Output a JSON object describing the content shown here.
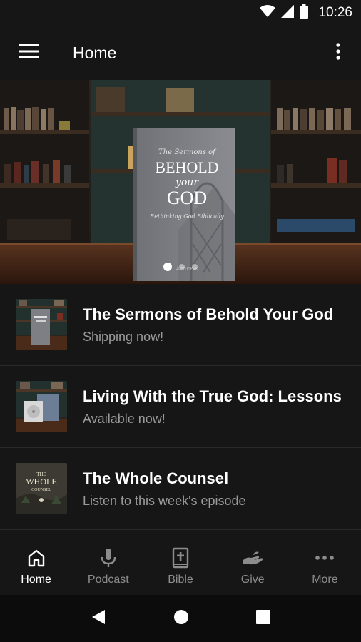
{
  "status_bar": {
    "time": "10:26"
  },
  "app_bar": {
    "title": "Home"
  },
  "hero": {
    "book_prefix": "The Sermons of",
    "book_title_1": "BEHOLD",
    "book_title_2": "your",
    "book_title_3": "GOD",
    "book_subtitle": "Rethinking God Biblically",
    "book_author": "JOHN PIPER",
    "slides": 3,
    "active_slide": 1
  },
  "list": {
    "items": [
      {
        "title": "The Sermons of Behold Your God",
        "subtitle": "Shipping now!"
      },
      {
        "title": "Living With the True God: Lessons",
        "subtitle": "Available now!"
      },
      {
        "title": "The Whole Counsel",
        "subtitle": "Listen to this week's episode",
        "thumb_text_1": "THE",
        "thumb_text_2": "WHOLE",
        "thumb_text_3": "COUNSEL"
      }
    ]
  },
  "bottom_nav": {
    "items": [
      {
        "label": "Home",
        "icon": "home-icon"
      },
      {
        "label": "Podcast",
        "icon": "microphone-icon"
      },
      {
        "label": "Bible",
        "icon": "bible-icon"
      },
      {
        "label": "Give",
        "icon": "hand-give-icon"
      },
      {
        "label": "More",
        "icon": "more-horizontal-icon"
      }
    ],
    "active_index": 0
  },
  "colors": {
    "background": "#161616",
    "text_primary": "#ffffff",
    "text_secondary": "#9a9a9a"
  }
}
